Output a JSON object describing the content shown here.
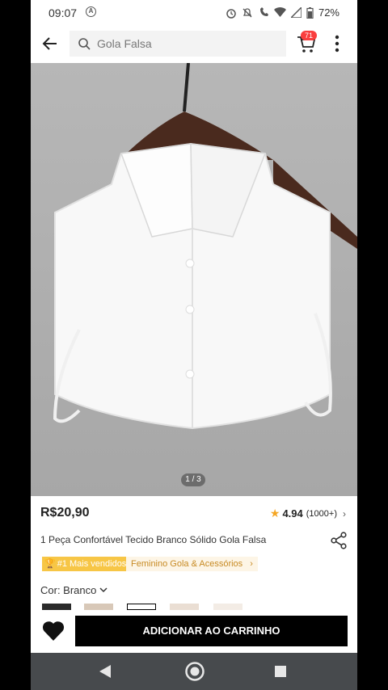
{
  "status_bar": {
    "time": "09:07",
    "battery": "72%"
  },
  "header": {
    "search_text": "Gola Falsa",
    "cart_count": "71"
  },
  "product": {
    "image_counter": "1 / 3",
    "price": "R$20,90",
    "rating": "4.94",
    "rating_count": "(1000+)",
    "title": "1 Peça Confortável Tecido Branco Sólido Gola Falsa",
    "best_seller_badge": "#1 Mais vendidos",
    "category": "Feminino Gola & Acessórios",
    "color_label": "Cor: Branco"
  },
  "actions": {
    "add_to_cart": "ADICIONAR AO CARRINHO"
  },
  "colors": {
    "accent_badge": "#f7c646",
    "category_text": "#c78a23",
    "cart_badge": "#fa3e3e",
    "star": "#f5a623"
  }
}
